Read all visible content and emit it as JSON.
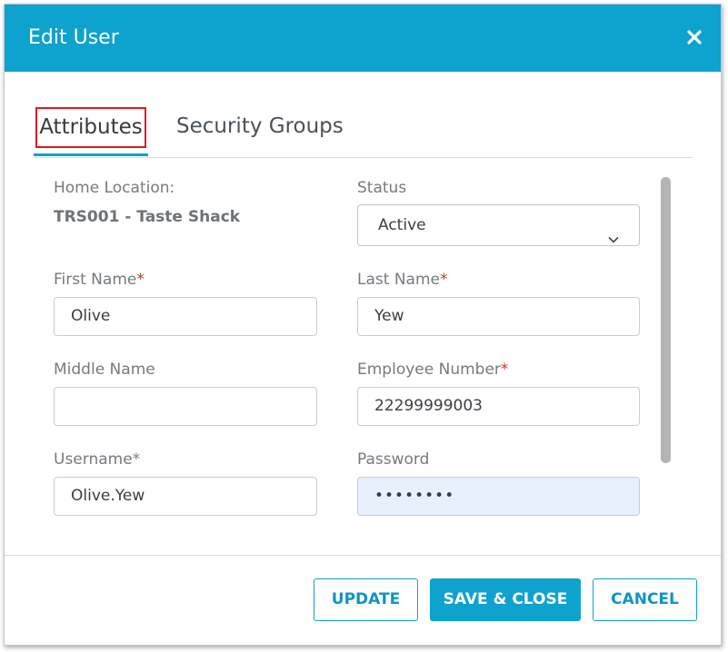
{
  "dialog": {
    "title": "Edit User",
    "close_icon": "close-icon",
    "accent_color": "#0ea2cf"
  },
  "tabs": [
    {
      "label": "Attributes",
      "active": true
    },
    {
      "label": "Security Groups",
      "active": false
    }
  ],
  "form": {
    "home_location": {
      "label": "Home Location:",
      "value": "TRS001 - Taste Shack"
    },
    "status": {
      "label": "Status",
      "value": "Active"
    },
    "first_name": {
      "label": "First Name",
      "required_mark": "*",
      "value": "Olive"
    },
    "last_name": {
      "label": "Last Name",
      "required_mark": "*",
      "value": "Yew"
    },
    "middle_name": {
      "label": "Middle Name",
      "value": ""
    },
    "employee_number": {
      "label": "Employee Number",
      "required_mark": "*",
      "value": "22299999003"
    },
    "username": {
      "label": "Username*",
      "value": "Olive.Yew"
    },
    "password": {
      "label": "Password",
      "value": "••••••••"
    }
  },
  "footer": {
    "update_label": "UPDATE",
    "save_close_label": "SAVE & CLOSE",
    "cancel_label": "CANCEL"
  }
}
